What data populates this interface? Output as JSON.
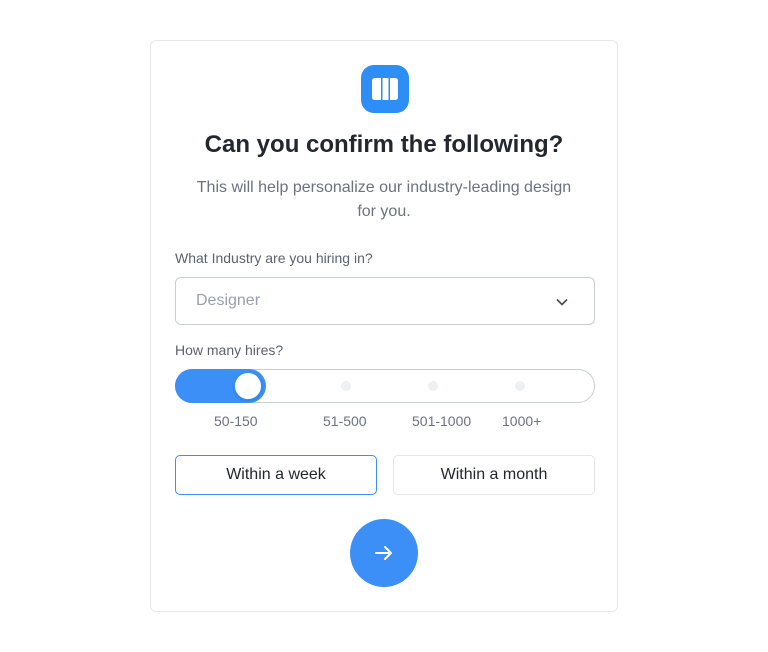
{
  "header": {
    "title": "Can you confirm the following?",
    "subtitle": "This will help personalize our industry-leading design for you."
  },
  "icons": {
    "logo": "brand-logo-icon",
    "dropdown": "chevron-down-icon",
    "next": "arrow-right-icon"
  },
  "industry": {
    "label": "What Industry are you hiring in?",
    "placeholder": "Designer"
  },
  "hires": {
    "label": "How many hires?",
    "options": [
      "50-150",
      "51-500",
      "501-1000",
      "1000+"
    ],
    "selected_index": 0
  },
  "timeframe": {
    "options": [
      "Within a week",
      "Within a month"
    ],
    "selected": "Within a week"
  },
  "colors": {
    "accent": "#3b8ff6",
    "logo": "#2d8ef7",
    "title": "#23272f",
    "muted": "#6b7280",
    "border": "#c9cdd4"
  }
}
